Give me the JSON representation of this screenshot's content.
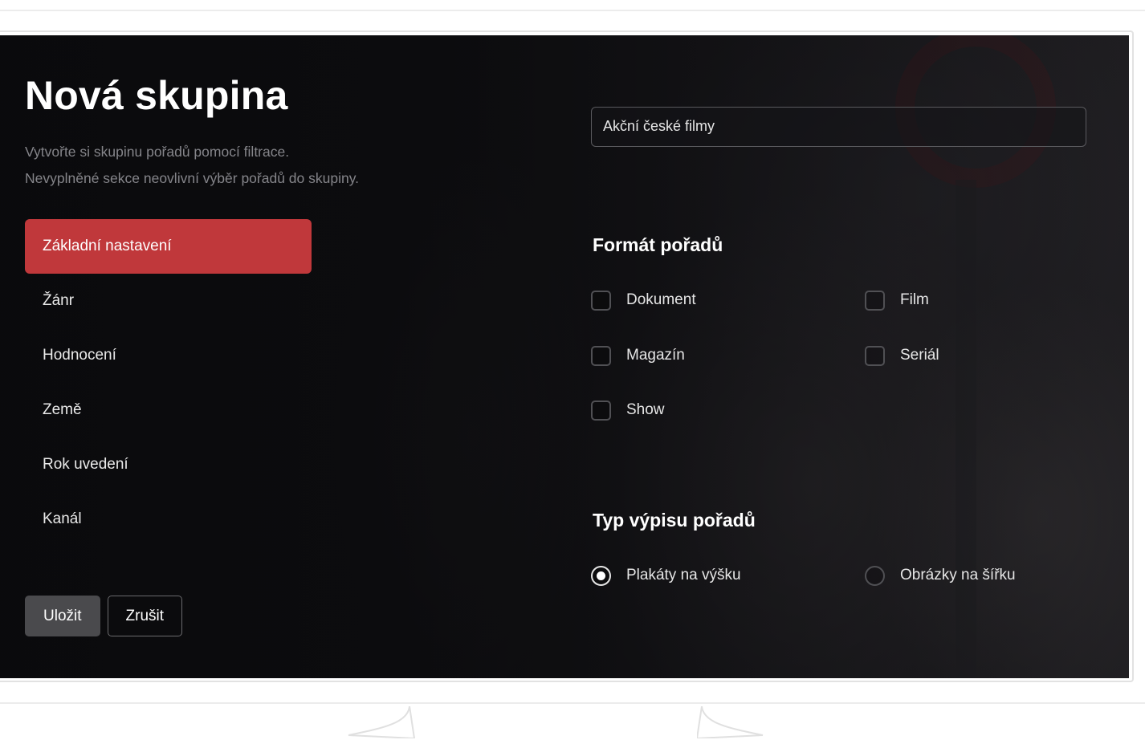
{
  "header": {
    "title": "Nová skupina",
    "subtitle_line1": "Vytvořte si skupinu pořadů pomocí filtrace.",
    "subtitle_line2": "Nevyplněné sekce neovlivní výběr pořadů do skupiny."
  },
  "sidebar": {
    "items": [
      {
        "label": "Základní nastavení",
        "active": true
      },
      {
        "label": "Žánr",
        "active": false
      },
      {
        "label": "Hodnocení",
        "active": false
      },
      {
        "label": "Země",
        "active": false
      },
      {
        "label": "Rok uvedení",
        "active": false
      },
      {
        "label": "Kanál",
        "active": false
      }
    ]
  },
  "actions": {
    "save_label": "Uložit",
    "cancel_label": "Zrušit"
  },
  "group_name_input": {
    "value": "Akční české filmy"
  },
  "format_section": {
    "title": "Formát pořadů",
    "options": [
      {
        "label": "Dokument",
        "checked": false
      },
      {
        "label": "Film",
        "checked": false
      },
      {
        "label": "Magazín",
        "checked": false
      },
      {
        "label": "Seriál",
        "checked": false
      },
      {
        "label": "Show",
        "checked": false
      }
    ]
  },
  "listing_section": {
    "title": "Typ výpisu pořadů",
    "options": [
      {
        "label": "Plakáty na výšku",
        "selected": true
      },
      {
        "label": "Obrázky na šířku",
        "selected": false
      }
    ]
  },
  "colors": {
    "accent": "#c0383b",
    "background": "#131316",
    "text": "#ffffff",
    "muted_text": "#85858a"
  }
}
